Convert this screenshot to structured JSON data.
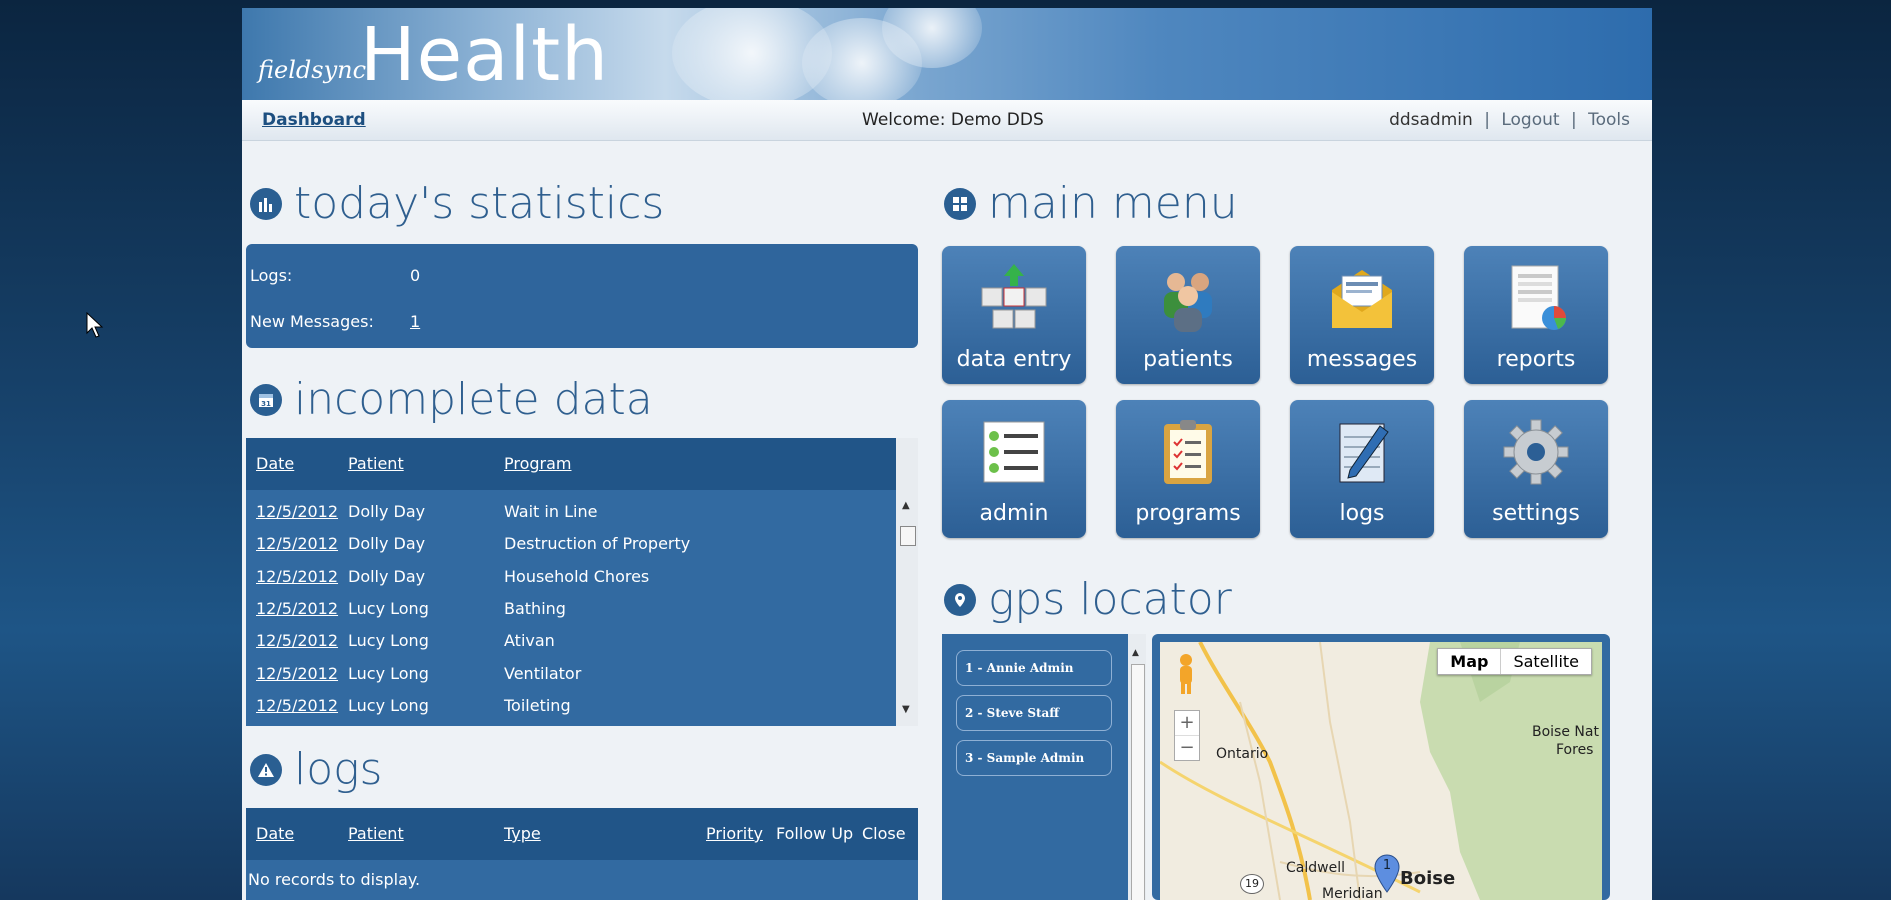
{
  "header": {
    "brand_small": "fieldsync",
    "brand_big": "Health"
  },
  "nav": {
    "dashboard": "Dashboard",
    "welcome": "Welcome: Demo DDS",
    "user": "ddsadmin",
    "sep": "|",
    "logout": "Logout",
    "tools": "Tools"
  },
  "statistics": {
    "title": "today's statistics",
    "logs_label": "Logs:",
    "logs_value": "0",
    "messages_label": "New Messages:",
    "messages_value": "1"
  },
  "incomplete": {
    "title": "incomplete data",
    "headers": {
      "date": "Date",
      "patient": "Patient",
      "program": "Program"
    },
    "rows": [
      {
        "date": "12/5/2012",
        "patient": "Dolly Day",
        "program": "Wait in Line"
      },
      {
        "date": "12/5/2012",
        "patient": "Dolly Day",
        "program": "Destruction of Property"
      },
      {
        "date": "12/5/2012",
        "patient": "Dolly Day",
        "program": "Household Chores"
      },
      {
        "date": "12/5/2012",
        "patient": "Lucy Long",
        "program": "Bathing"
      },
      {
        "date": "12/5/2012",
        "patient": "Lucy Long",
        "program": "Ativan"
      },
      {
        "date": "12/5/2012",
        "patient": "Lucy Long",
        "program": "Ventilator"
      },
      {
        "date": "12/5/2012",
        "patient": "Lucy Long",
        "program": "Toileting"
      }
    ]
  },
  "logs": {
    "title": "logs",
    "headers": {
      "date": "Date",
      "patient": "Patient",
      "type": "Type",
      "priority": "Priority",
      "followup": "Follow Up",
      "close": "Close"
    },
    "empty": "No records to display."
  },
  "main_menu": {
    "title": "main menu",
    "tiles": {
      "data_entry": "data entry",
      "patients": "patients",
      "messages": "messages",
      "reports": "reports",
      "admin": "admin",
      "programs": "programs",
      "logs": "logs",
      "settings": "settings"
    }
  },
  "gps": {
    "title": "gps locator",
    "people": [
      "1 - Annie Admin",
      "2 - Steve Staff",
      "3 - Sample Admin"
    ],
    "map_button": "Map",
    "satellite_button": "Satellite",
    "zoom_in": "+",
    "zoom_out": "−",
    "places": {
      "ontario": "Ontario",
      "caldwell": "Caldwell",
      "boise": "Boise",
      "meridian": "Meridian",
      "boise_forest_1": "Boise Nat",
      "boise_forest_2": "Fores",
      "route": "19"
    },
    "marker": "1"
  },
  "colors": {
    "panel": "#326aa1",
    "header": "#215588",
    "title": "#2f5f8f"
  }
}
